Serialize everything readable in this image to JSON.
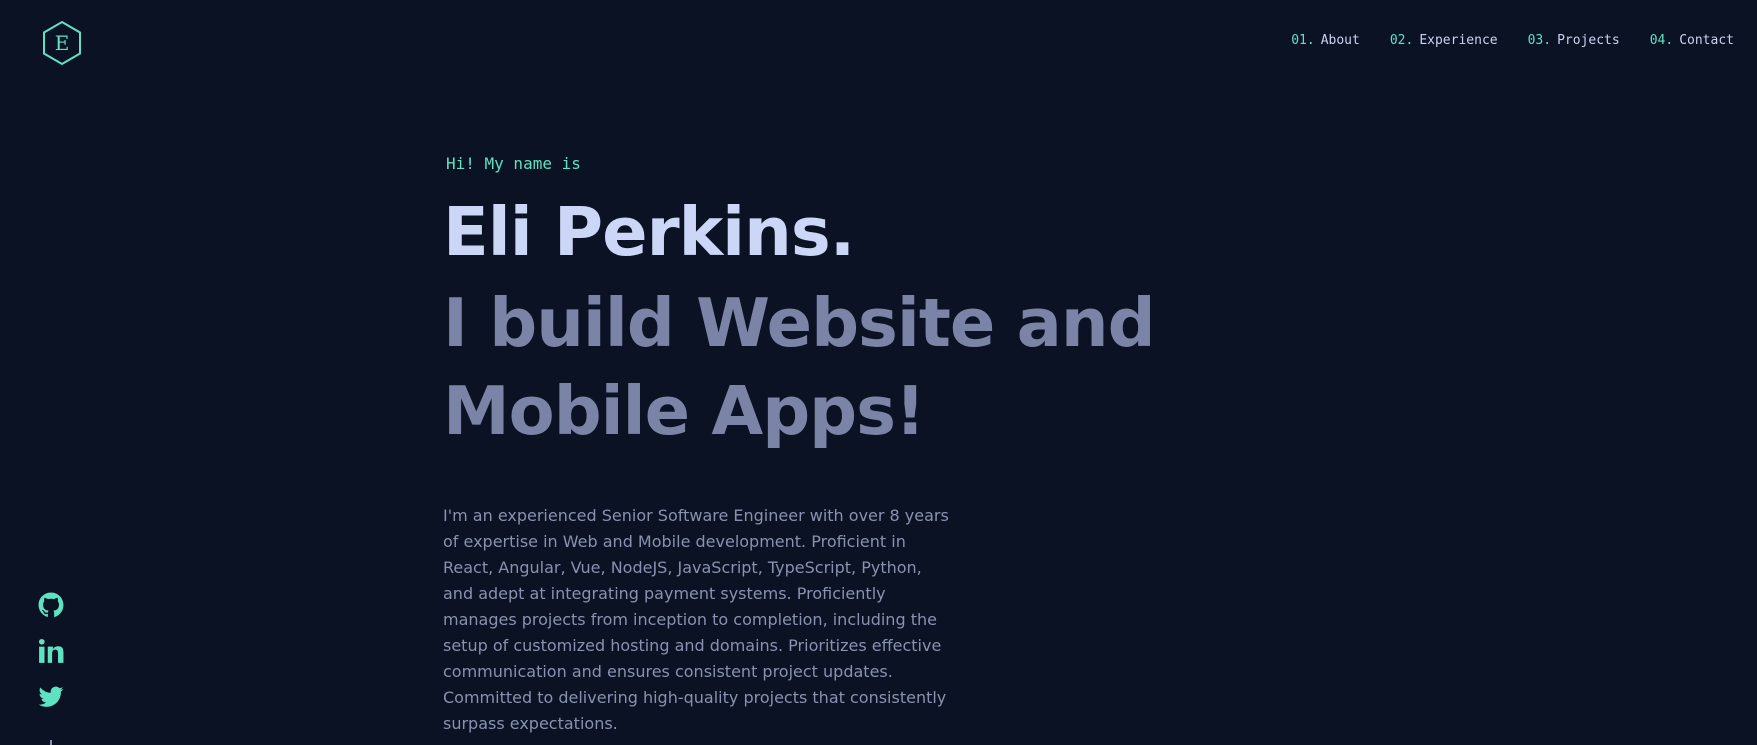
{
  "logo": {
    "letter": "E",
    "icon": "hexagon-logo-icon"
  },
  "nav": {
    "items": [
      {
        "number": "01.",
        "label": "About"
      },
      {
        "number": "02.",
        "label": "Experience"
      },
      {
        "number": "03.",
        "label": "Projects"
      },
      {
        "number": "04.",
        "label": "Contact"
      }
    ]
  },
  "hero": {
    "intro": "Hi! My name is",
    "name": "Eli Perkins.",
    "tagline": "I build Website and Mobile Apps!",
    "about": "I'm an experienced Senior Software Engineer with over 8 years of expertise in Web and Mobile development. Proficient in React, Angular, Vue, NodeJS, JavaScript, TypeScript, Python, and adept at integrating payment systems. Proficiently manages projects from inception to completion, including the setup of customized hosting and domains. Prioritizes effective communication and ensures consistent project updates. Committed to delivering high-quality projects that consistently surpass expectations."
  },
  "social": {
    "icons": [
      "github-icon",
      "linkedin-icon",
      "twitter-icon"
    ]
  },
  "colors": {
    "background": "#0b1224",
    "accent": "#5fe2c2",
    "heading": "#ccd6f6",
    "subheading": "#7b84a6",
    "body_text": "#8892b0"
  }
}
